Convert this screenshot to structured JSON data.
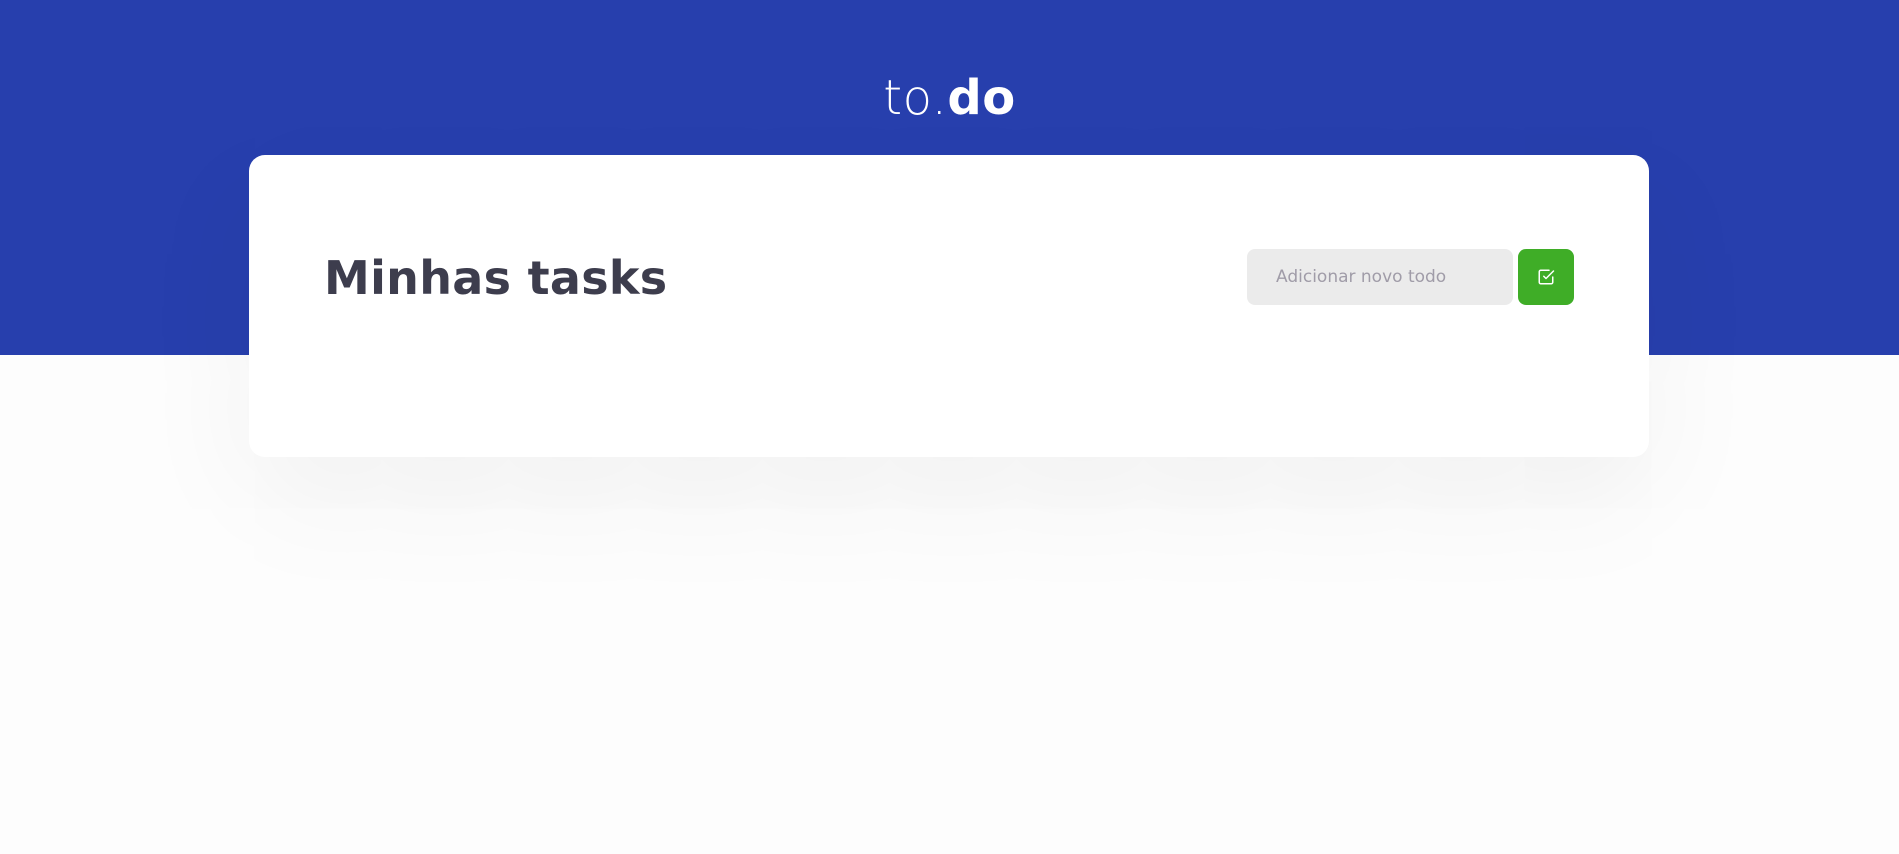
{
  "header": {
    "logo_prefix": "to.",
    "logo_suffix": "do"
  },
  "main": {
    "title": "Minhas tasks",
    "new_todo": {
      "placeholder": "Adicionar novo todo",
      "value": ""
    },
    "add_button_icon": "check-square-icon"
  },
  "colors": {
    "header_bg": "#273fad",
    "accent_green": "#3fad27",
    "title_text": "#3d3d4d",
    "input_bg": "#ebebeb",
    "placeholder_text": "#a09ca8"
  }
}
